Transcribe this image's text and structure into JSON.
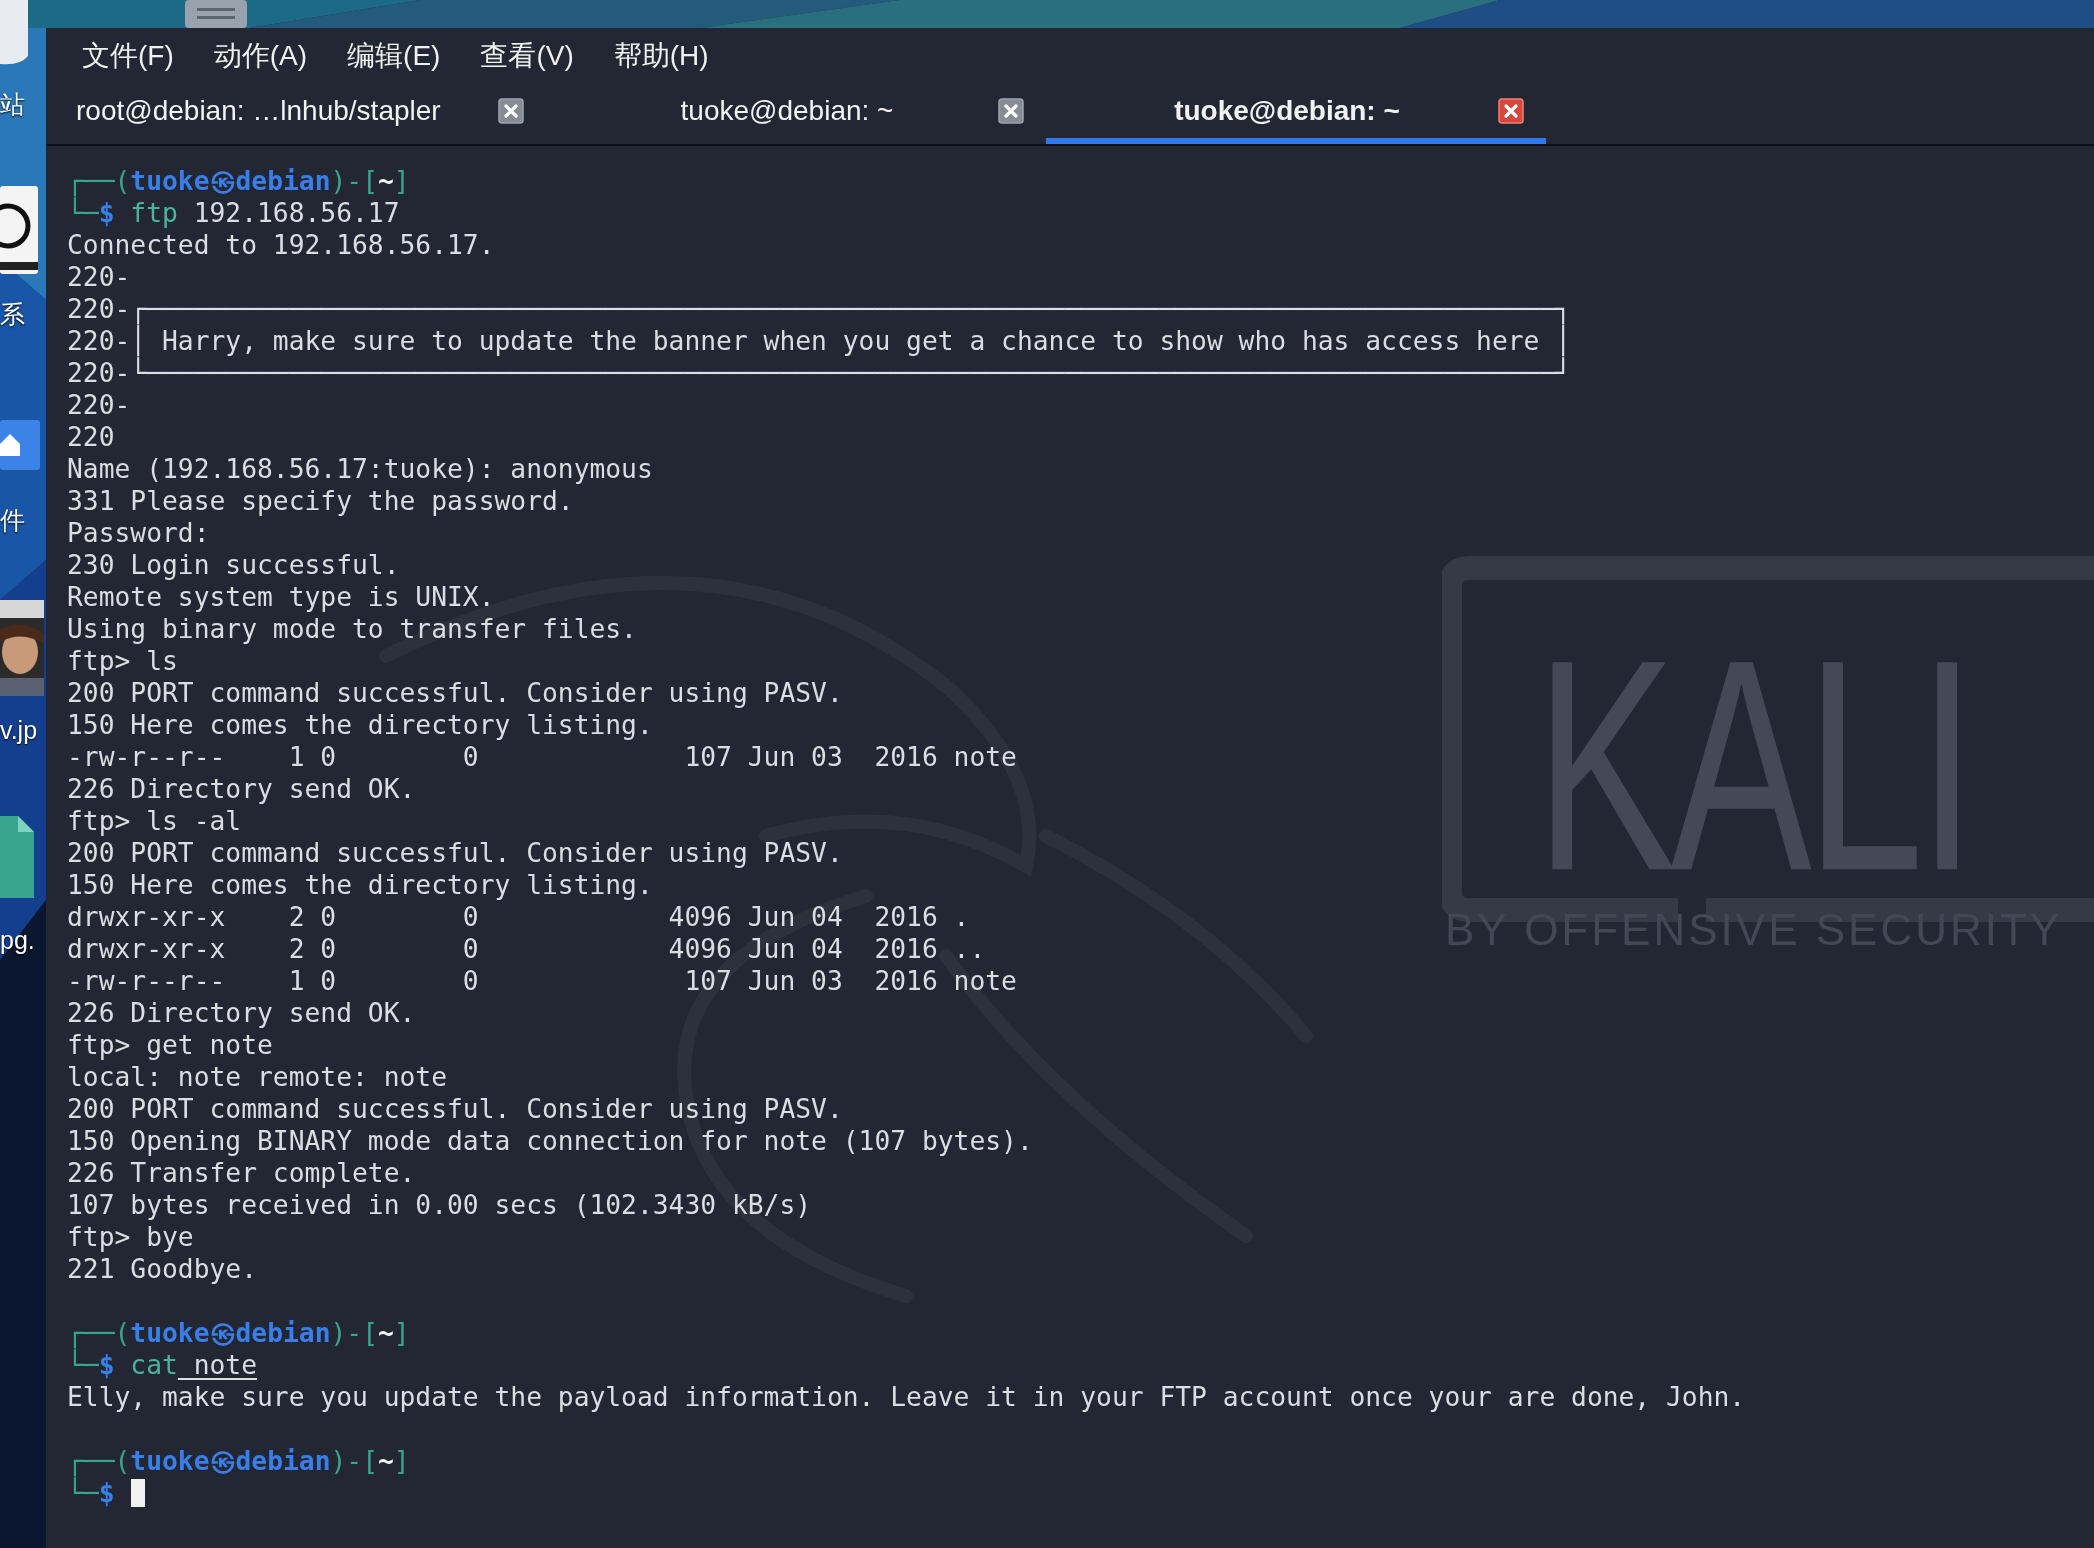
{
  "desktop": {
    "labels": [
      {
        "text": "站"
      },
      {
        "text": "系"
      },
      {
        "text": "件"
      },
      {
        "text": "v.jp"
      },
      {
        "text": "pg."
      }
    ]
  },
  "menu": [
    {
      "label": "文件(F)"
    },
    {
      "label": "动作(A)"
    },
    {
      "label": "编辑(E)"
    },
    {
      "label": "查看(V)"
    },
    {
      "label": "帮助(H)"
    }
  ],
  "tabs": [
    {
      "label": "root@debian: …lnhub/stapler",
      "selected": false
    },
    {
      "label": "tuoke@debian: ~",
      "selected": false
    },
    {
      "label": "tuoke@debian: ~",
      "selected": true
    }
  ],
  "wallpaper": {
    "logo": "KALI",
    "tagline": "BY OFFENSIVE SECURITY"
  },
  "terminal": {
    "lines": [
      {
        "kind": "prompt",
        "segments": [
          {
            "kind": "frame",
            "text": "┌──("
          },
          {
            "kind": "user",
            "text": "tuoke㉿debian"
          },
          {
            "kind": "frame",
            "text": ")-["
          },
          {
            "kind": "dir",
            "text": "~"
          },
          {
            "kind": "frame",
            "text": "]"
          }
        ]
      },
      {
        "kind": "command",
        "cursor": false,
        "segments": [
          {
            "kind": "frame",
            "text": "└─"
          },
          {
            "kind": "sigil",
            "text": "$"
          },
          {
            "kind": "cmd",
            "text": " ftp"
          },
          {
            "kind": "arg",
            "text": " 192.168.56.17"
          }
        ]
      },
      {
        "kind": "output",
        "text": "Connected to 192.168.56.17."
      },
      {
        "kind": "output",
        "text": "220-"
      },
      {
        "kind": "output",
        "text": "220-┌─────────────────────────────────────────────────────────────────────────────────────────┐"
      },
      {
        "kind": "output",
        "text": "220-│ Harry, make sure to update the banner when you get a chance to show who has access here │"
      },
      {
        "kind": "output",
        "text": "220-└─────────────────────────────────────────────────────────────────────────────────────────┘"
      },
      {
        "kind": "output",
        "text": "220-"
      },
      {
        "kind": "output",
        "text": "220"
      },
      {
        "kind": "output",
        "text": "Name (192.168.56.17:tuoke): anonymous"
      },
      {
        "kind": "output",
        "text": "331 Please specify the password."
      },
      {
        "kind": "output",
        "text": "Password:"
      },
      {
        "kind": "output",
        "text": "230 Login successful."
      },
      {
        "kind": "output",
        "text": "Remote system type is UNIX."
      },
      {
        "kind": "output",
        "text": "Using binary mode to transfer files."
      },
      {
        "kind": "output",
        "text": "ftp> ls"
      },
      {
        "kind": "output",
        "text": "200 PORT command successful. Consider using PASV."
      },
      {
        "kind": "output",
        "text": "150 Here comes the directory listing."
      },
      {
        "kind": "output",
        "text": "-rw-r--r--    1 0        0             107 Jun 03  2016 note"
      },
      {
        "kind": "output",
        "text": "226 Directory send OK."
      },
      {
        "kind": "output",
        "text": "ftp> ls -al"
      },
      {
        "kind": "output",
        "text": "200 PORT command successful. Consider using PASV."
      },
      {
        "kind": "output",
        "text": "150 Here comes the directory listing."
      },
      {
        "kind": "output",
        "text": "drwxr-xr-x    2 0        0            4096 Jun 04  2016 ."
      },
      {
        "kind": "output",
        "text": "drwxr-xr-x    2 0        0            4096 Jun 04  2016 .."
      },
      {
        "kind": "output",
        "text": "-rw-r--r--    1 0        0             107 Jun 03  2016 note"
      },
      {
        "kind": "output",
        "text": "226 Directory send OK."
      },
      {
        "kind": "output",
        "text": "ftp> get note"
      },
      {
        "kind": "output",
        "text": "local: note remote: note"
      },
      {
        "kind": "output",
        "text": "200 PORT command successful. Consider using PASV."
      },
      {
        "kind": "output",
        "text": "150 Opening BINARY mode data connection for note (107 bytes)."
      },
      {
        "kind": "output",
        "text": "226 Transfer complete."
      },
      {
        "kind": "output",
        "text": "107 bytes received in 0.00 secs (102.3430 kB/s)"
      },
      {
        "kind": "output",
        "text": "ftp> bye"
      },
      {
        "kind": "output",
        "text": "221 Goodbye."
      },
      {
        "kind": "blank"
      },
      {
        "kind": "prompt",
        "segments": [
          {
            "kind": "frame",
            "text": "┌──("
          },
          {
            "kind": "user",
            "text": "tuoke㉿debian"
          },
          {
            "kind": "frame",
            "text": ")-["
          },
          {
            "kind": "dir",
            "text": "~"
          },
          {
            "kind": "frame",
            "text": "]"
          }
        ]
      },
      {
        "kind": "command",
        "cursor": false,
        "segments": [
          {
            "kind": "frame",
            "text": "└─"
          },
          {
            "kind": "sigil",
            "text": "$"
          },
          {
            "kind": "cmd",
            "text": " cat"
          },
          {
            "kind": "path",
            "text": " note"
          }
        ]
      },
      {
        "kind": "output",
        "text": "Elly, make sure you update the payload information. Leave it in your FTP account once your are done, John."
      },
      {
        "kind": "blank"
      },
      {
        "kind": "prompt",
        "segments": [
          {
            "kind": "frame",
            "text": "┌──("
          },
          {
            "kind": "user",
            "text": "tuoke㉿debian"
          },
          {
            "kind": "frame",
            "text": ")-["
          },
          {
            "kind": "dir",
            "text": "~"
          },
          {
            "kind": "frame",
            "text": "]"
          }
        ]
      },
      {
        "kind": "command",
        "cursor": true,
        "segments": [
          {
            "kind": "frame",
            "text": "└─"
          },
          {
            "kind": "sigil",
            "text": "$"
          }
        ]
      }
    ]
  }
}
